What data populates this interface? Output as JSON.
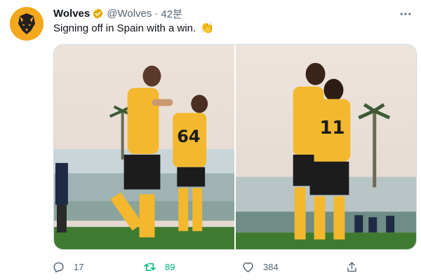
{
  "tweet": {
    "author_name": "Wolves",
    "handle": "@Wolves",
    "separator": "·",
    "time": "42분",
    "text": "Signing off in Spain with a win.",
    "emoji": "👏"
  },
  "media": {
    "left_photo": {
      "shirt_number": "64"
    },
    "right_photo": {
      "shirt_number": "11"
    }
  },
  "actions": {
    "reply_count": "17",
    "retweet_count": "89",
    "like_count": "384"
  },
  "colors": {
    "brand": "#f3a81d",
    "verified": "#e6a800",
    "retweet_active": "#00ba7c",
    "muted": "#536471"
  }
}
